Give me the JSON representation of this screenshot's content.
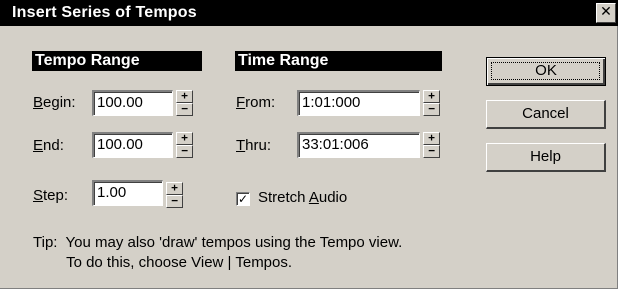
{
  "window": {
    "title": "Insert Series of Tempos",
    "close_glyph": "✕"
  },
  "tempo_range": {
    "header": "Tempo Range",
    "begin": {
      "label_ul": "B",
      "label_rest": "egin:",
      "value": "100.00"
    },
    "end": {
      "label_ul": "E",
      "label_rest": "nd:",
      "value": "100.00"
    },
    "step": {
      "label_ul": "S",
      "label_rest": "tep:",
      "value": "1.00"
    }
  },
  "time_range": {
    "header": "Time Range",
    "from": {
      "label_ul": "F",
      "label_rest": "rom:",
      "value": "1:01:000"
    },
    "thru": {
      "label_ul": "T",
      "label_rest": "hru:",
      "value": "33:01:006"
    }
  },
  "stretch_audio": {
    "checked": true,
    "check_glyph": "✓",
    "label_pre": "Stretch ",
    "label_ul": "A",
    "label_post": "udio"
  },
  "buttons": {
    "ok": "OK",
    "cancel": "Cancel",
    "help": "Help"
  },
  "spinner": {
    "up_glyph": "+",
    "down_glyph": "−"
  },
  "tip": {
    "line1": "Tip:  You may also 'draw' tempos using the Tempo view.",
    "line2": "        To do this, choose View | Tempos."
  },
  "colors": {
    "dialog_bg": "#d4d0c8",
    "title_bg": "#000000",
    "header_bg": "#000000"
  }
}
